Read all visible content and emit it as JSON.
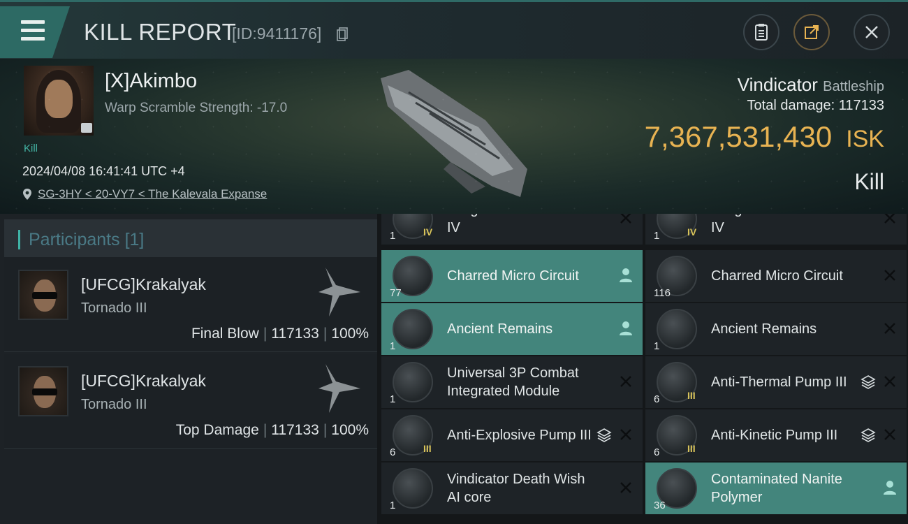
{
  "header": {
    "title": "KILL REPORT",
    "report_id": "[ID:9411176]",
    "icons": [
      "menu-icon",
      "copy-icon",
      "clipboard-icon",
      "share-icon",
      "close-icon"
    ]
  },
  "victim": {
    "name": "[X]Akimbo",
    "subtitle": "Warp Scramble Strength: -17.0",
    "kill_tag": "Kill",
    "datetime": "2024/04/08 16:41:41 UTC +4",
    "location": "SG-3HY < 20-VY7 < The Kalevala Expanse"
  },
  "ship": {
    "name": "Vindicator",
    "class": "Battleship",
    "total_damage_label": "Total damage:",
    "total_damage": "117133",
    "value": "7,367,531,430",
    "currency": "ISK",
    "result": "Kill"
  },
  "participants": {
    "title": "Participants",
    "count": "[1]",
    "cards": [
      {
        "name": "[UFCG]Krakalyak",
        "ship": "Tornado III",
        "role": "Final Blow",
        "damage": "117133",
        "percent": "100%"
      },
      {
        "name": "[UFCG]Krakalyak",
        "ship": "Tornado III",
        "role": "Top Damage",
        "damage": "117133",
        "percent": "100%"
      }
    ]
  },
  "items_left": [
    {
      "qty": "1",
      "tier": "IV",
      "name": "Kuligan Burst Aerator IV",
      "state": "destroyed"
    },
    {
      "qty": "77",
      "tier": "",
      "name": "Charred Micro Circuit",
      "state": "dropped"
    },
    {
      "qty": "1",
      "tier": "",
      "name": "Ancient Remains",
      "state": "dropped"
    },
    {
      "qty": "1",
      "tier": "",
      "name": "Universal 3P Combat Integrated Module",
      "state": "destroyed"
    },
    {
      "qty": "6",
      "tier": "III",
      "name": "Anti-Explosive Pump III",
      "state": "destroyed",
      "stack": true
    },
    {
      "qty": "1",
      "tier": "",
      "name": "Vindicator Death Wish AI core",
      "state": "destroyed"
    }
  ],
  "items_right": [
    {
      "qty": "1",
      "tier": "IV",
      "name": "Kuligan Burst Aerator IV",
      "state": "destroyed"
    },
    {
      "qty": "116",
      "tier": "",
      "name": "Charred Micro Circuit",
      "state": "destroyed"
    },
    {
      "qty": "1",
      "tier": "",
      "name": "Ancient Remains",
      "state": "destroyed"
    },
    {
      "qty": "6",
      "tier": "III",
      "name": "Anti-Thermal Pump III",
      "state": "destroyed",
      "stack": true
    },
    {
      "qty": "6",
      "tier": "III",
      "name": "Anti-Kinetic Pump III",
      "state": "destroyed",
      "stack": true
    },
    {
      "qty": "36",
      "tier": "",
      "name": "Contaminated Nanite Polymer",
      "state": "dropped"
    }
  ],
  "colors": {
    "accent": "#43857c",
    "isk": "#e8b352",
    "teal": "#3fb3a6"
  }
}
